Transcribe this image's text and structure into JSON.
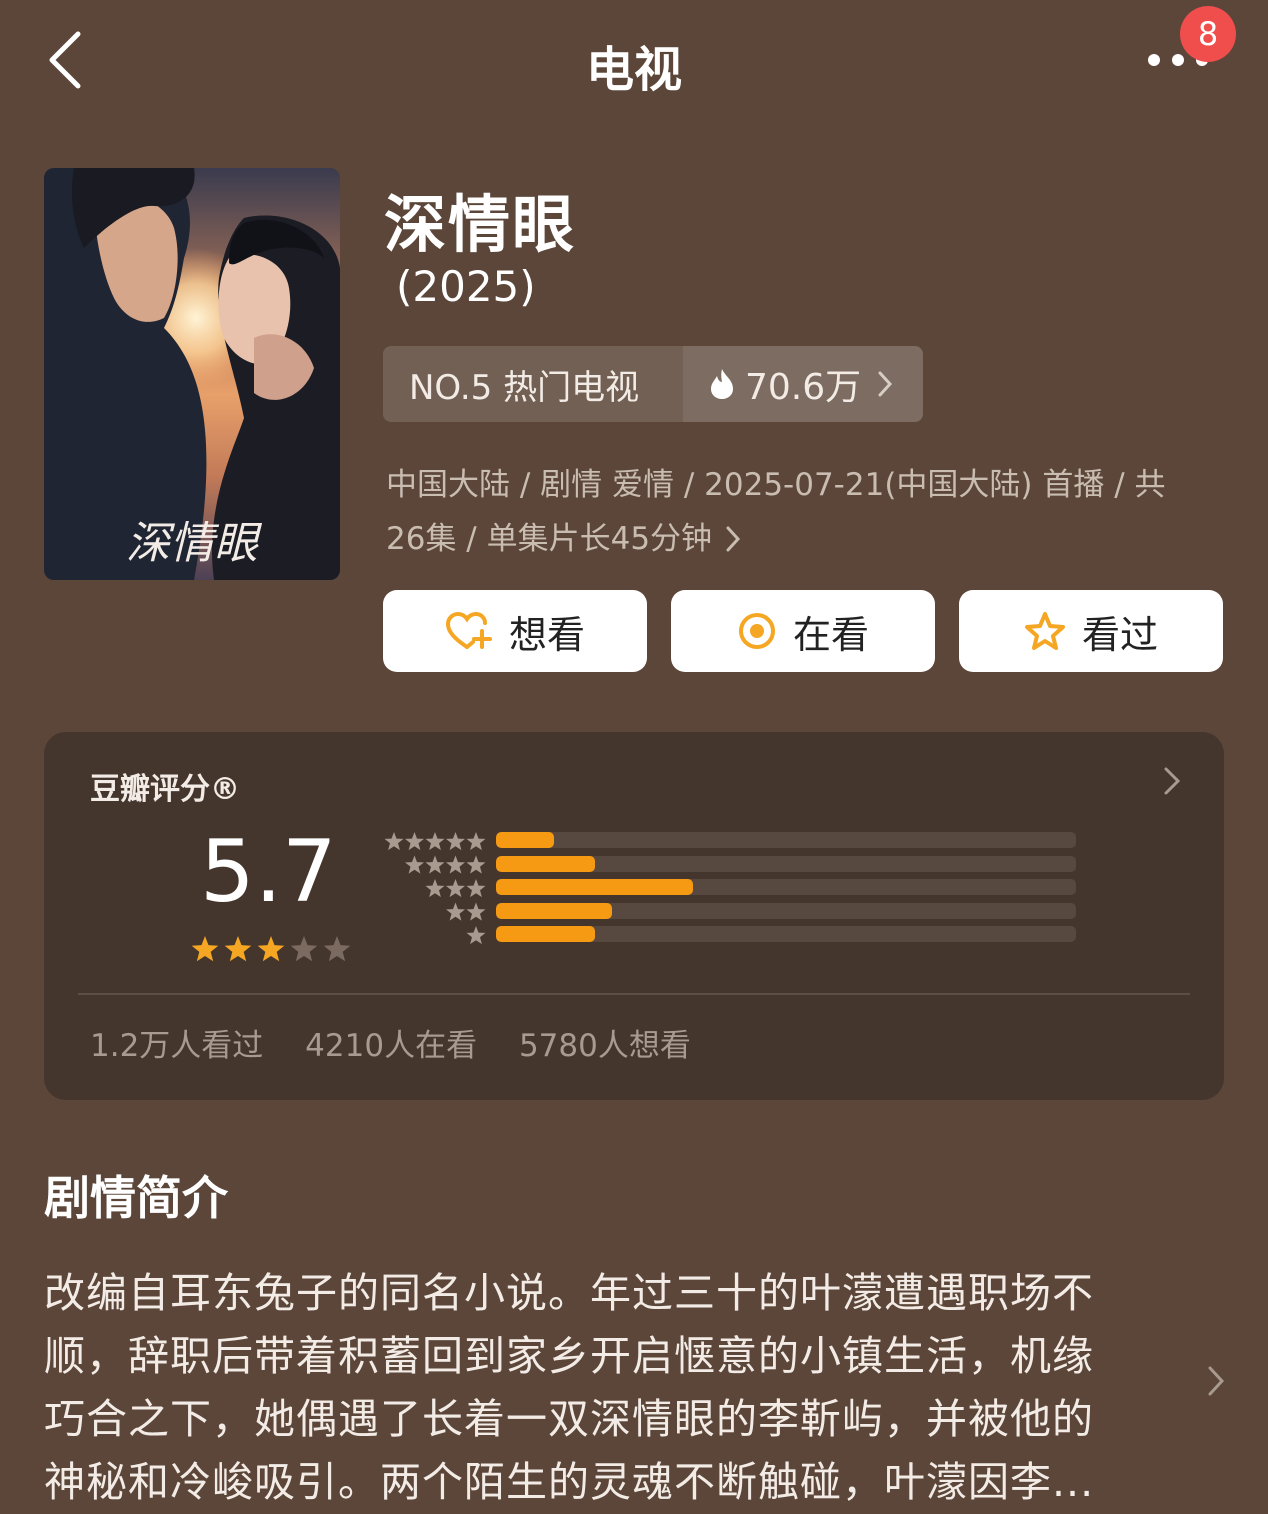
{
  "header": {
    "title": "电视",
    "back_icon": "chevron-left-icon",
    "more_icon": "more-dots-icon",
    "notification_count": "8"
  },
  "show": {
    "title": "深情眼",
    "year": "(2025)",
    "poster_calligraphy": "深情眼",
    "rank_label": "NO.5 热门电视",
    "heat_value": "70.6万",
    "heat_icon": "flame-icon",
    "meta_line1": "中国大陆 / 剧情 爱情 / 2025-07-21(中国大陆) 首播 / 共",
    "meta_line2": "26集 / 单集片长45分钟"
  },
  "actions": [
    {
      "label": "想看",
      "icon": "heart-plus-icon"
    },
    {
      "label": "在看",
      "icon": "target-icon"
    },
    {
      "label": "看过",
      "icon": "star-outline-icon"
    }
  ],
  "rating": {
    "label": "豆瓣评分®",
    "score": "5.7",
    "stars": 3,
    "distribution": [
      {
        "stars": 5,
        "fraction": 0.1
      },
      {
        "stars": 4,
        "fraction": 0.17
      },
      {
        "stars": 3,
        "fraction": 0.34
      },
      {
        "stars": 2,
        "fraction": 0.2
      },
      {
        "stars": 1,
        "fraction": 0.17
      }
    ],
    "watched": "1.2万人看过",
    "watching": "4210人在看",
    "want": "5780人想看"
  },
  "synopsis": {
    "title": "剧情简介",
    "line1": "改编自耳东兔子的同名小说。年过三十的叶濛遭遇职场不",
    "line2": "顺，辞职后带着积蓄回到家乡开启惬意的小镇生活，机缘",
    "line3": "巧合之下，她偶遇了长着一双深情眼的李靳屿，并被他的",
    "line4": "神秘和冷峻吸引。两个陌生的灵魂不断触碰，叶濛因李..."
  },
  "colors": {
    "background": "#5b4639",
    "card": "#44352d",
    "accent": "#f59a12",
    "badge": "#f04d4d"
  }
}
